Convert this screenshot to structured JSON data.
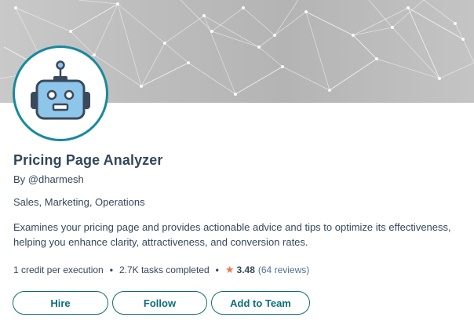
{
  "profile": {
    "title": "Pricing Page Analyzer",
    "byline": "By @dharmesh",
    "categories": "Sales, Marketing, Operations",
    "description": "Examines your pricing page and provides actionable advice and tips to optimize its effectiveness, helping you enhance clarity, attractiveness, and conversion rates.",
    "avatar_icon": "robot-icon"
  },
  "stats": {
    "credits": "1 credit per execution",
    "tasks": "2.7K tasks completed",
    "rating": "3.48",
    "reviews": "(64 reviews)",
    "separator": "•",
    "star_icon": "star-icon",
    "star_color": "#f2734e"
  },
  "actions": {
    "hire": "Hire",
    "follow": "Follow",
    "add_to_team": "Add to Team"
  },
  "colors": {
    "accent": "#0b6e7a",
    "avatar_border": "#168a9c",
    "robot_face": "#8ec5ea",
    "text": "#33475b"
  }
}
